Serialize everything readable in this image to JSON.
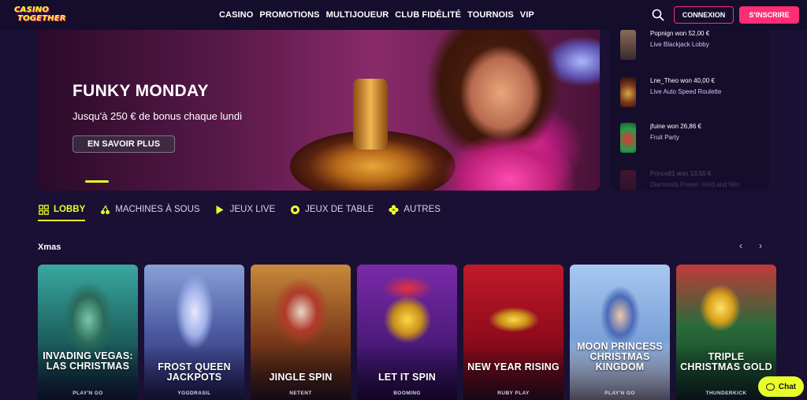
{
  "header": {
    "logo_line1": "CASINO",
    "logo_line2": "TOGETHER",
    "nav": [
      "CASINO",
      "PROMOTIONS",
      "MULTIJOUEUR",
      "CLUB FIDÉLITÉ",
      "TOURNOIS",
      "VIP"
    ],
    "login_label": "CONNEXION",
    "signup_label": "S'INSCRIRE"
  },
  "hero": {
    "title": "FUNKY MONDAY",
    "subtitle": "Jusqu'à 250 € de bonus chaque lundi",
    "cta": "EN SAVOIR PLUS"
  },
  "wins": [
    {
      "name": "Popnign won 52,00 €",
      "game": "Live Blackjack Lobby",
      "color": "#6a4a3a"
    },
    {
      "name": "Lne_Theo won 40,00 €",
      "game": "Live Auto Speed Roulette",
      "color": "#7a3a1a"
    },
    {
      "name": "jfuine won 26,86 €",
      "game": "Fruit Party",
      "color": "#2a9a4a"
    },
    {
      "name": "Prince81 won 13,50 €",
      "game": "Diamonds Power: Hold and Win",
      "color": "#8a2a2a"
    }
  ],
  "tabs": [
    {
      "label": "LOBBY",
      "icon": "grid-icon"
    },
    {
      "label": "MACHINES À SOUS",
      "icon": "cherry-icon"
    },
    {
      "label": "JEUX LIVE",
      "icon": "play-icon"
    },
    {
      "label": "JEUX DE TABLE",
      "icon": "chip-icon"
    },
    {
      "label": "AUTRES",
      "icon": "clover-icon"
    }
  ],
  "section": {
    "title": "Xmas"
  },
  "games": [
    {
      "title": "INVADING VEGAS: LAS CHRISTMAS",
      "provider": "PLAY'N GO",
      "color": "#2a7a6a"
    },
    {
      "title": "FROST QUEEN JACKPOTS",
      "provider": "YGGDRASIL",
      "color": "#4a6aa8"
    },
    {
      "title": "JINGLE SPIN",
      "provider": "NETENT",
      "color": "#8a4a3a"
    },
    {
      "title": "LET IT SPIN",
      "provider": "BOOMING",
      "color": "#5a1a8a"
    },
    {
      "title": "NEW YEAR RISING",
      "provider": "RUBY PLAY",
      "color": "#b01a2a"
    },
    {
      "title": "MOON PRINCESS CHRISTMAS KINGDOM",
      "provider": "PLAY'N GO",
      "color": "#7aa0d8"
    },
    {
      "title": "TRIPLE CHRISTMAS GOLD",
      "provider": "THUNDERKICK",
      "color": "#1a5a3a"
    }
  ],
  "chat": {
    "label": "Chat"
  }
}
